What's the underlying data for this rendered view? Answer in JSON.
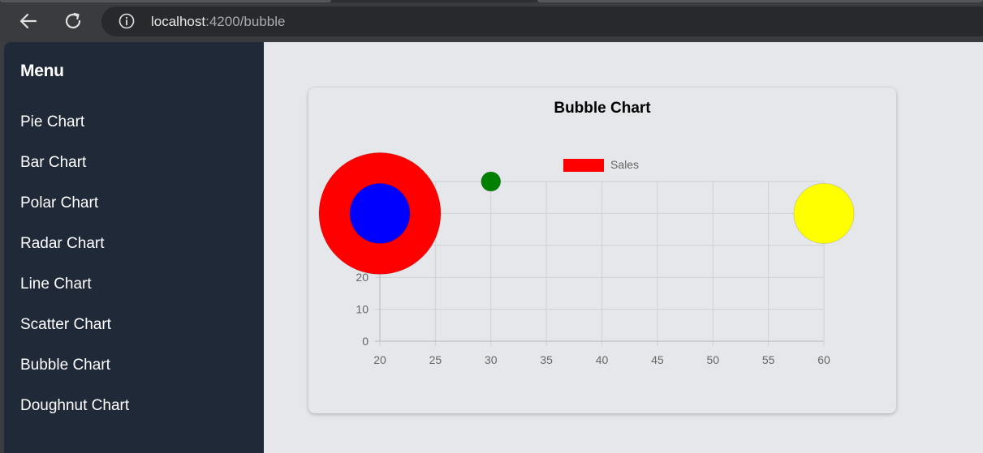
{
  "browser": {
    "url_host": "localhost",
    "url_path": ":4200/bubble"
  },
  "sidebar": {
    "title": "Menu",
    "items": [
      {
        "label": "Pie Chart"
      },
      {
        "label": "Bar Chart"
      },
      {
        "label": "Polar Chart"
      },
      {
        "label": "Radar Chart"
      },
      {
        "label": "Line Chart"
      },
      {
        "label": "Scatter Chart"
      },
      {
        "label": "Bubble Chart"
      },
      {
        "label": "Doughnut Chart"
      }
    ]
  },
  "card": {
    "title": "Bubble Chart"
  },
  "chart_data": {
    "type": "bubble",
    "legend_position": "top",
    "grid": true,
    "xlim": [
      20,
      60
    ],
    "ylim": [
      0,
      50
    ],
    "x_ticks": [
      20,
      25,
      30,
      35,
      40,
      45,
      50,
      55,
      60
    ],
    "y_ticks_visible": [
      0,
      10,
      20
    ],
    "series": [
      {
        "name": "Sales",
        "legend_color": "#ff0000",
        "points": [
          {
            "x": 20,
            "y": 40,
            "r": 75,
            "color": "#ff0000"
          },
          {
            "x": 20,
            "y": 40,
            "r": 37,
            "color": "#0000ff"
          },
          {
            "x": 30,
            "y": 50,
            "r": 12,
            "color": "#008000"
          },
          {
            "x": 60,
            "y": 40,
            "r": 37,
            "color": "#ffff00"
          }
        ]
      }
    ]
  }
}
